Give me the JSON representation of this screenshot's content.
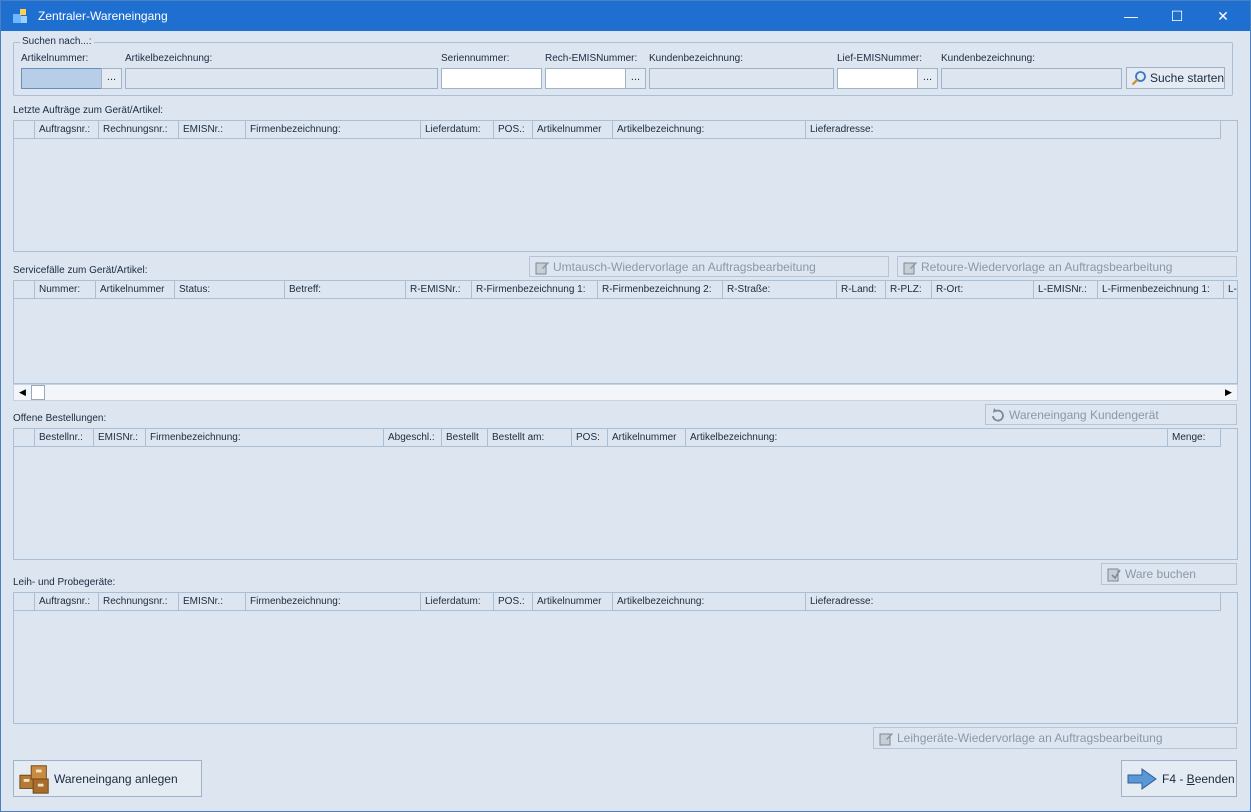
{
  "window": {
    "title": "Zentraler-Wareneingang",
    "minimize_glyph": "—",
    "maximize_glyph": "☐",
    "close_glyph": "✕"
  },
  "search": {
    "group_title": "Suchen nach...:",
    "labels": {
      "artikelnummer": "Artikelnummer:",
      "artikelbezeichnung": "Artikelbezeichnung:",
      "seriennummer": "Seriennummer:",
      "rech_emis": "Rech-EMISNummer:",
      "kundenbezeichnung1": "Kundenbezeichnung:",
      "lief_emis": "Lief-EMISNummer:",
      "kundenbezeichnung2": "Kundenbezeichnung:"
    },
    "values": {
      "artikelnummer": "",
      "artikelbezeichnung": "",
      "seriennummer": "",
      "rech_emis": "",
      "kundenbezeichnung1": "",
      "lief_emis": "",
      "kundenbezeichnung2": ""
    },
    "dots_label": "...",
    "search_button": "Suche starten"
  },
  "letzte_auftraege": {
    "title": "Letzte Aufträge zum Gerät/Artikel:",
    "columns": [
      "",
      "Auftragsnr.:",
      "Rechnungsnr.:",
      "EMISNr.:",
      "Firmenbezeichnung:",
      "Lieferdatum:",
      "POS.:",
      "Artikelnummer",
      "Artikelbezeichnung:",
      "Lieferadresse:"
    ]
  },
  "servicefaelle": {
    "title": "Servicefälle zum Gerät/Artikel:",
    "button_umtausch": "Umtausch-Wiedervorlage an Auftragsbearbeitung",
    "button_retoure": "Retoure-Wiedervorlage an Auftragsbearbeitung",
    "columns": [
      "",
      "Nummer:",
      "Artikelnummer",
      "Status:",
      "Betreff:",
      "R-EMISNr.:",
      "R-Firmenbezeichnung 1:",
      "R-Firmenbezeichnung 2:",
      "R-Straße:",
      "R-Land:",
      "R-PLZ:",
      "R-Ort:",
      "L-EMISNr.:",
      "L-Firmenbezeichnung 1:",
      "L-"
    ],
    "scroll_left": "◀",
    "scroll_right": "▶"
  },
  "offene_bestellungen": {
    "title": "Offene Bestellungen:",
    "button_wareneingang": "Wareneingang Kundengerät",
    "columns": [
      "",
      "Bestellnr.:",
      "EMISNr.:",
      "Firmenbezeichnung:",
      "Abgeschl.:",
      "Bestellt",
      "Bestellt am:",
      "POS:",
      "Artikelnummer",
      "Artikelbezeichnung:",
      "Menge:"
    ]
  },
  "leihgeraete": {
    "title": "Leih- und Probegeräte:",
    "button_ware_buchen": "Ware buchen",
    "button_leih_wiedervorlage": "Leihgeräte-Wiedervorlage an Auftragsbearbeitung",
    "columns": [
      "",
      "Auftragsnr.:",
      "Rechnungsnr.:",
      "EMISNr.:",
      "Firmenbezeichnung:",
      "Lieferdatum:",
      "POS.:",
      "Artikelnummer",
      "Artikelbezeichnung:",
      "Lieferadresse:"
    ]
  },
  "footer": {
    "wareneingang_anlegen": "Wareneingang anlegen",
    "beenden_prefix": "F4 - ",
    "beenden_hotkey": "B",
    "beenden_rest": "eenden"
  }
}
